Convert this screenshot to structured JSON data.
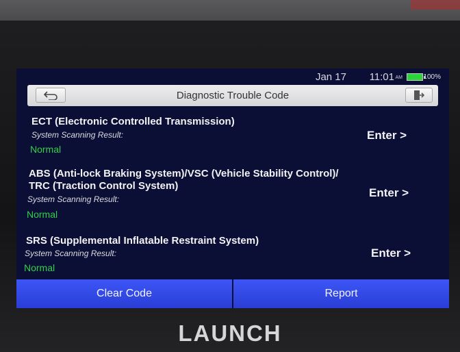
{
  "status_bar": {
    "date": "Jan 17",
    "time": "11:01",
    "ampm": "AM",
    "battery": "100%"
  },
  "header": {
    "title": "Diagnostic Trouble Code",
    "back_icon": "back-arrow-icon",
    "exit_icon": "exit-icon"
  },
  "systems": [
    {
      "name": "ECT (Electronic Controlled Transmission)",
      "scan_label": "System Scanning Result:",
      "result": "Normal",
      "enter": "Enter >"
    },
    {
      "name": "ABS (Anti-lock Braking System)/VSC (Vehicle Stability Control)/ TRC (Traction Control System)",
      "scan_label": "System Scanning Result:",
      "result": "Normal",
      "enter": "Enter >"
    },
    {
      "name": "SRS (Supplemental Inflatable Restraint System)",
      "scan_label": "System Scanning Result:",
      "result": "Normal",
      "enter": "Enter >"
    }
  ],
  "footer": {
    "clear_code": "Clear Code",
    "report": "Report"
  },
  "brand": "LAUNCH",
  "colors": {
    "screen_bg": "#0b0e35",
    "button_blue": "#3047e6",
    "normal_green": "#2fd24a",
    "battery_green": "#2bd23a"
  }
}
